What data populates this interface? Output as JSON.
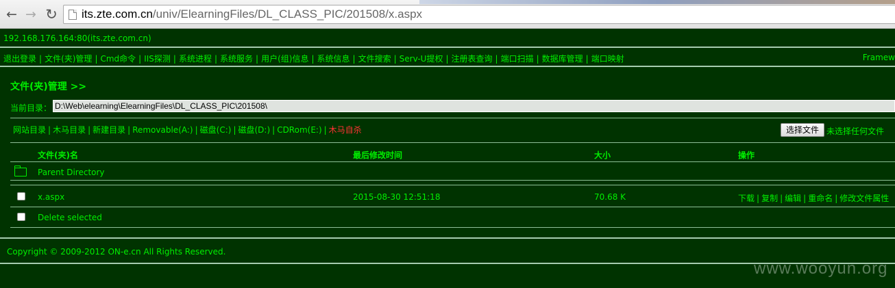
{
  "browser": {
    "url_host": "its.zte.com.cn",
    "url_path": "/univ/ElearningFiles/DL_CLASS_PIC/201508/x.aspx"
  },
  "page": {
    "host_line": "192.168.176.164:80(its.zte.com.cn)",
    "menu": [
      "退出登录",
      "文件(夹)管理",
      "Cmd命令",
      "IIS探测",
      "系统进程",
      "系统服务",
      "用户(组)信息",
      "系统信息",
      "文件搜索",
      "Serv-U提权",
      "注册表查询",
      "端口扫描",
      "数据库管理",
      "端口映射"
    ],
    "menu_right": "Framew",
    "section_title": "文件(夹)管理 >>",
    "current_dir_label": "当前目录：",
    "current_dir_value": "D:\\Web\\elearning\\ElearningFiles\\DL_CLASS_PIC\\201508\\",
    "drives": [
      "网站目录",
      "木马目录",
      "新建目录",
      "Removable(A:)",
      "磁盘(C:)",
      "磁盘(D:)",
      "CDRom(E:)"
    ],
    "drive_kill": "木马自杀",
    "choose_file_button": "选择文件",
    "choose_file_status": "未选择任何文件",
    "table": {
      "headers": {
        "name": "文件(夹)名",
        "modified": "最后修改时间",
        "size": "大小",
        "action": "操作"
      },
      "parent_dir": "Parent Directory",
      "rows": [
        {
          "name": "x.aspx",
          "modified": "2015-08-30 12:51:18",
          "size": "70.68 K",
          "actions": [
            "下载",
            "复制",
            "编辑",
            "重命名",
            "修改文件属性"
          ]
        }
      ],
      "delete_selected": "Delete selected"
    },
    "copyright": "Copyright © 2009-2012 ON-e.cn All Rights Reserved."
  },
  "watermark": "www.wooyun.org",
  "colors": {
    "background": "#003300",
    "text": "#00ee00",
    "danger": "#ff3333"
  }
}
